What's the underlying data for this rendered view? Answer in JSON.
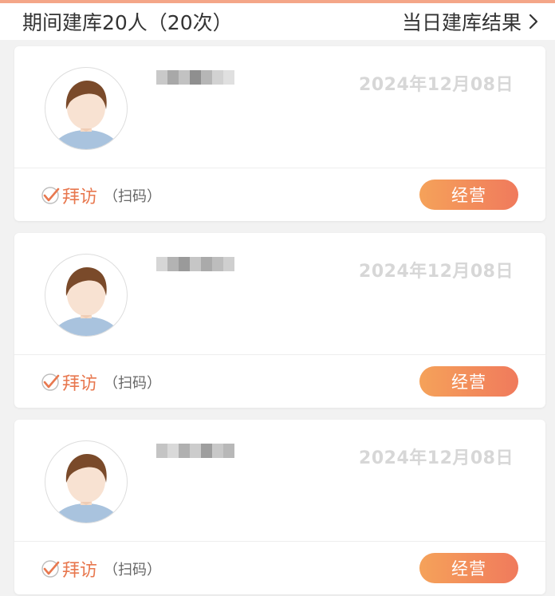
{
  "header": {
    "left_text": "期间建库20人（20次）",
    "right_text": "当日建库结果",
    "chevron_icon": "chevron-right-icon"
  },
  "colors": {
    "accent_orange": "#e8784f",
    "button_gradient_start": "#f5a25a",
    "button_gradient_end": "#f07a5c",
    "date_text": "#d7d7d7",
    "top_strip": "#f4a688"
  },
  "records": [
    {
      "name": "",
      "date": "2024年12月08日",
      "visit_label": "拜访",
      "visit_sub": "（扫码）",
      "action_label": "经营"
    },
    {
      "name": "",
      "date": "2024年12月08日",
      "visit_label": "拜访",
      "visit_sub": "（扫码）",
      "action_label": "经营"
    },
    {
      "name": "",
      "date": "2024年12月08日",
      "visit_label": "拜访",
      "visit_sub": "（扫码）",
      "action_label": "经营"
    }
  ]
}
